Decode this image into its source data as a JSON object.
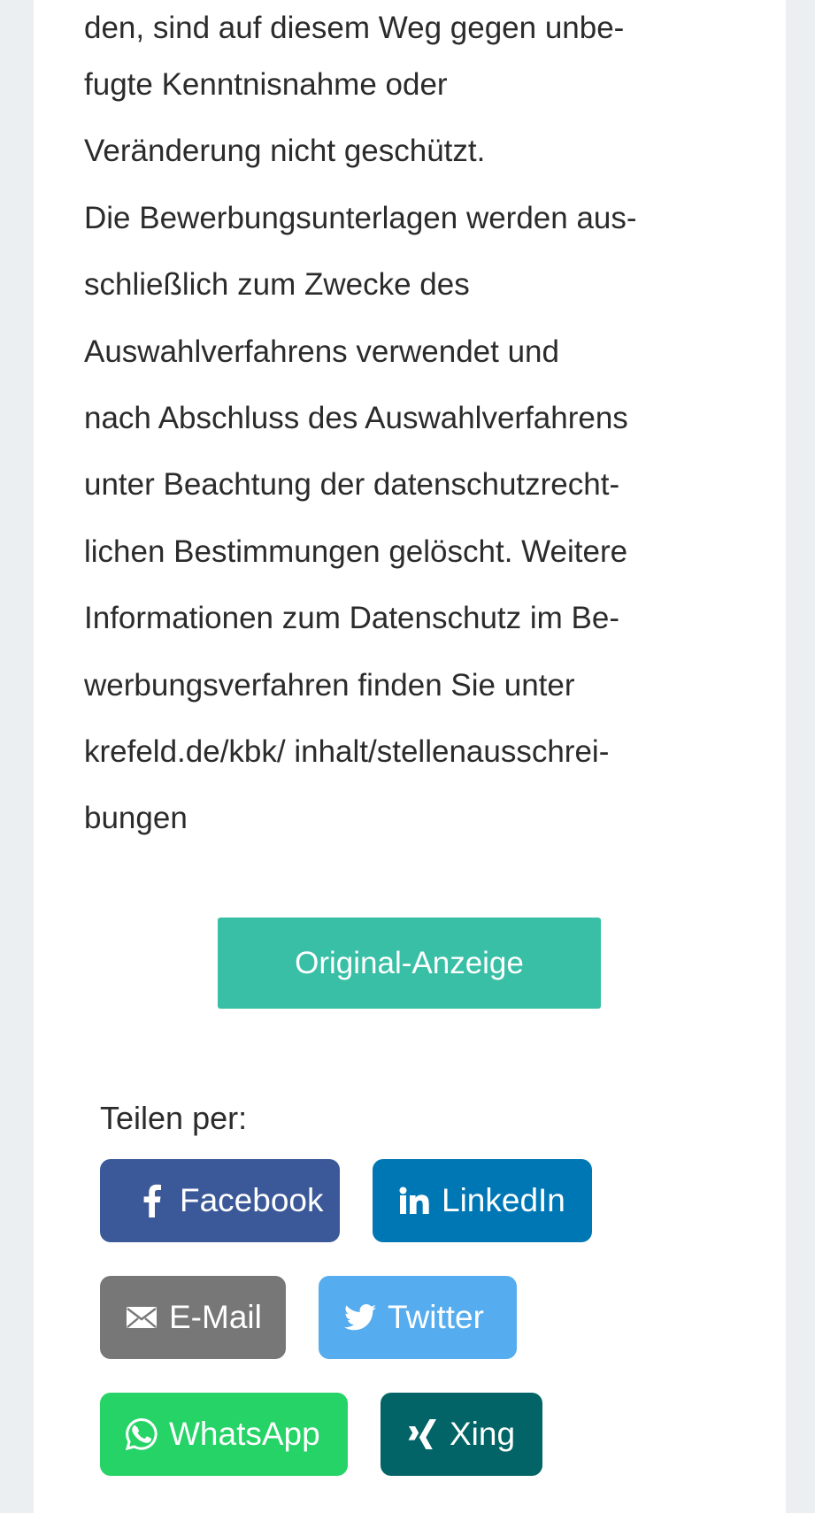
{
  "article": {
    "lines": [
      "den, sind auf diesem Weg gegen unbe-",
      "fugte Kenntnisnahme oder",
      "Veränderung nicht geschützt.",
      "Die Bewerbungsunterlagen werden aus-",
      "schließlich zum Zwecke des",
      "Auswahlverfahrens verwendet und",
      "nach Abschluss des Auswahlverfahrens",
      "unter Beachtung der datenschutzrecht-",
      "lichen Bestimmungen gelöscht. Weitere",
      "Informationen zum Datenschutz im Be-",
      "werbungsverfahren finden Sie unter",
      "krefeld.de/kbk/ inhalt/stellenausschrei-",
      "bungen"
    ]
  },
  "original_button": {
    "label": "Original-Anzeige",
    "color": "#38bfa5"
  },
  "share": {
    "label": "Teilen per:",
    "buttons": [
      {
        "label": "Facebook",
        "icon": "facebook-icon",
        "color": "#3b5998"
      },
      {
        "label": "LinkedIn",
        "icon": "linkedin-icon",
        "color": "#0077b5"
      },
      {
        "label": "E-Mail",
        "icon": "email-icon",
        "color": "#777777"
      },
      {
        "label": "Twitter",
        "icon": "twitter-icon",
        "color": "#55acee"
      },
      {
        "label": "WhatsApp",
        "icon": "whatsapp-icon",
        "color": "#25d366"
      },
      {
        "label": "Xing",
        "icon": "xing-icon",
        "color": "#026466"
      }
    ]
  }
}
